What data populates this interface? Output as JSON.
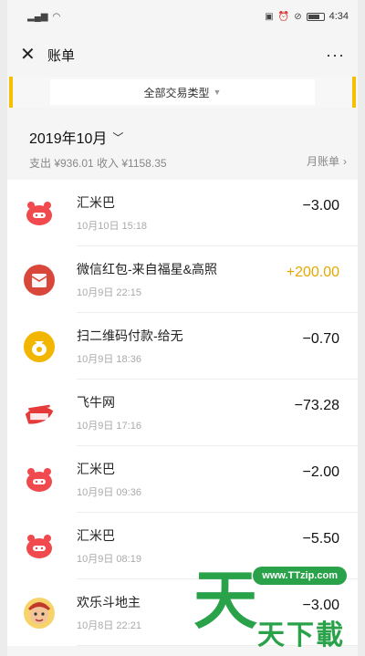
{
  "statusbar": {
    "left": "…ıl …",
    "time": "4:34"
  },
  "nav": {
    "title": "账单"
  },
  "filter": {
    "label": "全部交易类型"
  },
  "month": {
    "label": "2019年10月",
    "summary": "支出 ¥936.01 收入 ¥1158.35",
    "bill_link": "月账单"
  },
  "transactions": [
    {
      "name": "汇米巴",
      "time": "10月10日 15:18",
      "amount": "−3.00",
      "icon": "pig-icon"
    },
    {
      "name": "微信红包-来自福星&高照",
      "time": "10月9日 22:15",
      "amount": "+200.00",
      "icon": "red-packet-icon"
    },
    {
      "name": "扫二维码付款-给无",
      "time": "10月9日 18:36",
      "amount": "−0.70",
      "icon": "money-bag-icon"
    },
    {
      "name": "飞牛网",
      "time": "10月9日 17:16",
      "amount": "−73.28",
      "icon": "feiniu-logo"
    },
    {
      "name": "汇米巴",
      "time": "10月9日 09:36",
      "amount": "−2.00",
      "icon": "pig-icon"
    },
    {
      "name": "汇米巴",
      "time": "10月9日 08:19",
      "amount": "−5.50",
      "icon": "pig-icon"
    },
    {
      "name": "欢乐斗地主",
      "time": "10月8日 22:21",
      "amount": "−3.00",
      "icon": "game-avatar"
    }
  ],
  "watermark": {
    "url": "www.TTzip.com",
    "big": "天",
    "small": "天下載"
  },
  "colors": {
    "accent": "#f6c000",
    "income": "#e6a800",
    "pig": "#f04a4f",
    "watermark": "#2aa24a"
  }
}
